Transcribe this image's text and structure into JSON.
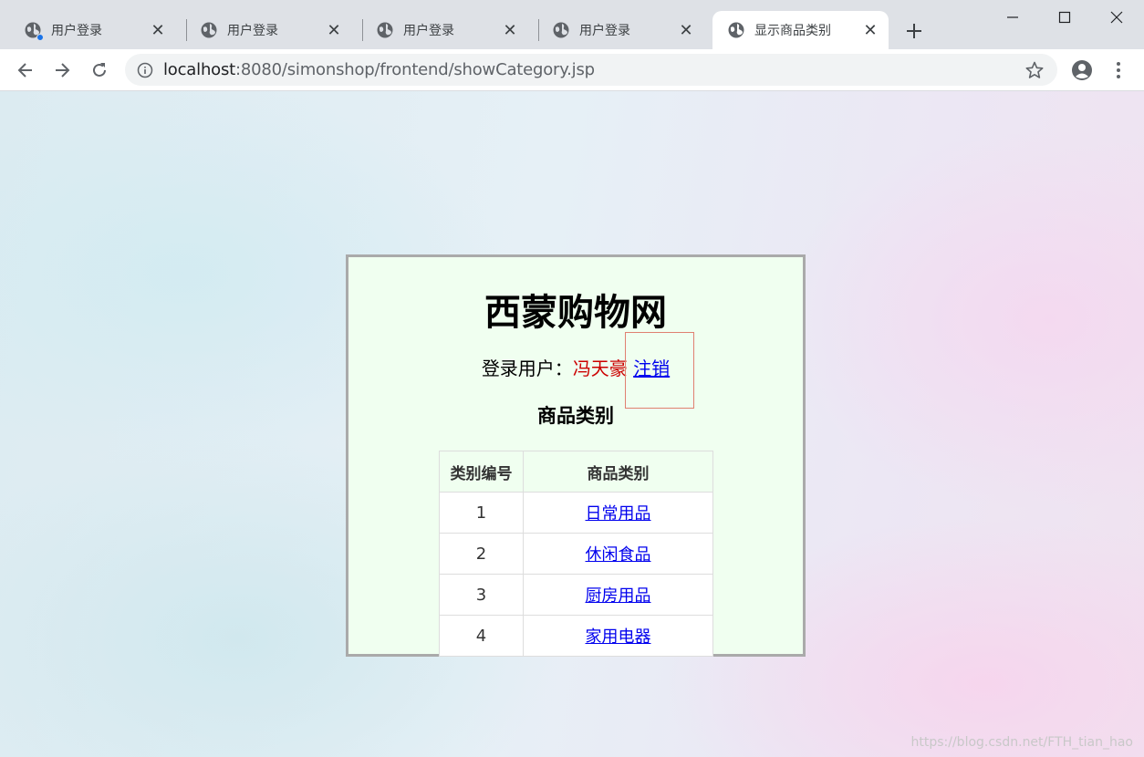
{
  "browser": {
    "tabs": [
      {
        "title": "用户登录",
        "active": false,
        "recording_dot": true
      },
      {
        "title": "用户登录",
        "active": false,
        "recording_dot": false
      },
      {
        "title": "用户登录",
        "active": false,
        "recording_dot": false
      },
      {
        "title": "用户登录",
        "active": false,
        "recording_dot": false
      },
      {
        "title": "显示商品类别",
        "active": true,
        "recording_dot": false
      }
    ],
    "url_host": "localhost",
    "url_rest": ":8080/simonshop/frontend/showCategory.jsp",
    "icons": {
      "back": "back-arrow-icon",
      "forward": "forward-arrow-icon",
      "reload": "reload-icon",
      "info": "info-icon",
      "star": "star-icon",
      "account": "account-icon",
      "menu": "more-vert-icon"
    }
  },
  "page": {
    "site_title": "西蒙购物网",
    "login_label": "登录用户：",
    "username": "冯天豪",
    "logout_link": "注销",
    "section_title": "商品类别",
    "table": {
      "headers": [
        "类别编号",
        "商品类别"
      ],
      "rows": [
        {
          "id": "1",
          "name": "日常用品"
        },
        {
          "id": "2",
          "name": "休闲食品"
        },
        {
          "id": "3",
          "name": "厨房用品"
        },
        {
          "id": "4",
          "name": "家用电器"
        }
      ]
    }
  },
  "watermark": "https://blog.csdn.net/FTH_tian_hao",
  "colors": {
    "panel_bg": "#f0fff0",
    "username": "#cc0000",
    "link": "#0000ee",
    "highlight_box": "#e08070"
  }
}
